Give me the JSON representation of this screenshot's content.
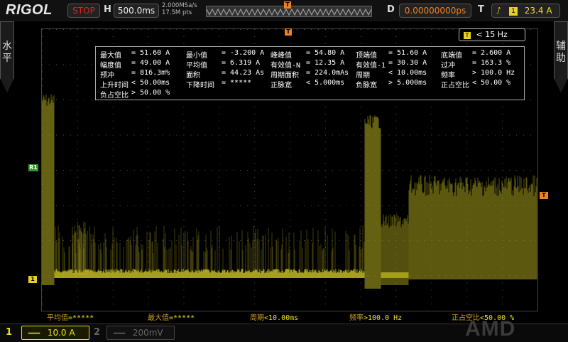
{
  "top": {
    "logo": "RIGOL",
    "run_status": "STOP",
    "h_label": "H",
    "timebase": "500.0ms",
    "sample_rate": "2.000MSa/s",
    "points": "17.5M pts",
    "trig_pos_marker": "T",
    "d_label": "D",
    "delay": "0.00000000ps",
    "t_label": "T",
    "trig_source": "1",
    "trig_level": "23.4 A"
  },
  "side": {
    "left": "水平",
    "right": "辅助"
  },
  "freq_box": {
    "icon": "T",
    "value": "< 15 Hz"
  },
  "measurements": [
    [
      "最大值",
      "= 51.60 A"
    ],
    [
      "最小值",
      "= -3.200 A"
    ],
    [
      "峰峰值",
      "= 54.80 A"
    ],
    [
      "顶端值",
      "= 51.60 A"
    ],
    [
      "底端值",
      "= 2.600 A"
    ],
    [
      "幅度值",
      "= 49.00 A"
    ],
    [
      "平均值",
      "= 6.319 A"
    ],
    [
      "有效值-N",
      "= 12.35 A"
    ],
    [
      "有效值-1",
      "= 30.30 A"
    ],
    [
      "过冲",
      "= 163.3 %"
    ],
    [
      "预冲",
      "= 816.3m%"
    ],
    [
      "面积",
      "= 44.23 As"
    ],
    [
      "周期面积",
      "= 224.0mAs"
    ],
    [
      "周期",
      "< 10.00ms"
    ],
    [
      "频率",
      "> 100.0 Hz"
    ],
    [
      "上升时间",
      "< 50.00ms"
    ],
    [
      "下降时间",
      "= *****"
    ],
    [
      "正脉宽",
      "< 5.000ms"
    ],
    [
      "负脉宽",
      "> 5.000ms"
    ],
    [
      "正占空比",
      "< 50.00 %"
    ],
    [
      "负占空比",
      "> 50.00 %"
    ]
  ],
  "markers": {
    "top": "T",
    "ch1": "1",
    "r1": "R1",
    "right": "T"
  },
  "strip": [
    {
      "label": "平均值",
      "value": "=*****"
    },
    {
      "label": "最大值",
      "value": "=*****"
    },
    {
      "label": "周期",
      "value": "<10.00ms"
    },
    {
      "label": "频率",
      "value": ">100.0 Hz"
    },
    {
      "label": "正占空比",
      "value": "<50.00 %"
    }
  ],
  "bottom": {
    "ch1_num": "1",
    "ch1_coupling": "═══",
    "ch1_scale": "10.0 A",
    "ch2_num": "2",
    "ch2_coupling": "═══",
    "ch2_scale": "200mV",
    "watermark": "AMD"
  },
  "colors": {
    "trace": "#b8b020",
    "ch1": "#e8e020",
    "trigger": "#f08020",
    "stop": "#e02020"
  }
}
